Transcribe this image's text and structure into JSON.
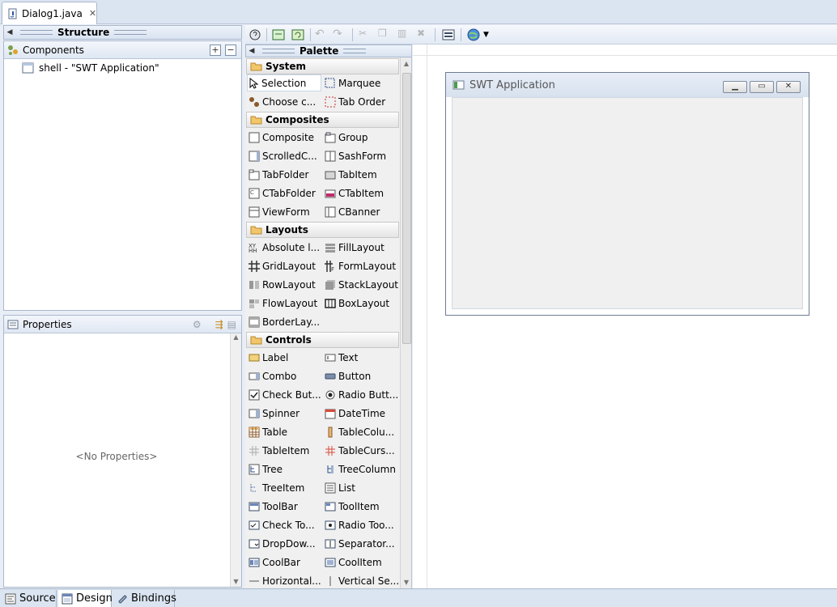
{
  "editor": {
    "tab_label": "Dialog1.java"
  },
  "structure": {
    "title": "Structure",
    "components_label": "Components",
    "tree_item": "shell - \"SWT Application\""
  },
  "properties": {
    "title": "Properties",
    "empty_text": "<No Properties>"
  },
  "palette": {
    "title": "Palette",
    "categories": [
      "System",
      "Composites",
      "Layouts",
      "Controls"
    ],
    "system": [
      "Selection",
      "Marquee",
      "Choose c...",
      "Tab Order"
    ],
    "composites": [
      "Composite",
      "Group",
      "ScrolledC...",
      "SashForm",
      "TabFolder",
      "TabItem",
      "CTabFolder",
      "CTabItem",
      "ViewForm",
      "CBanner"
    ],
    "layouts": [
      "Absolute l...",
      "FillLayout",
      "GridLayout",
      "FormLayout",
      "RowLayout",
      "StackLayout",
      "FlowLayout",
      "BoxLayout",
      "BorderLay..."
    ],
    "controls": [
      "Label",
      "Text",
      "Combo",
      "Button",
      "Check But...",
      "Radio Butt...",
      "Spinner",
      "DateTime",
      "Table",
      "TableColu...",
      "TableItem",
      "TableCurs...",
      "Tree",
      "TreeColumn",
      "TreeItem",
      "List",
      "ToolBar",
      "ToolItem",
      "Check To...",
      "Radio Too...",
      "DropDow...",
      "Separator...",
      "CoolBar",
      "CoolItem",
      "Horizontal...",
      "Vertical Se..."
    ]
  },
  "design": {
    "shell_title": "SWT Application"
  },
  "bottom_tabs": [
    "Source",
    "Design",
    "Bindings"
  ],
  "colors": {
    "accent": "#dbe5f1",
    "selection_bg": "#ffffff",
    "frame": "#a9b8cc"
  }
}
